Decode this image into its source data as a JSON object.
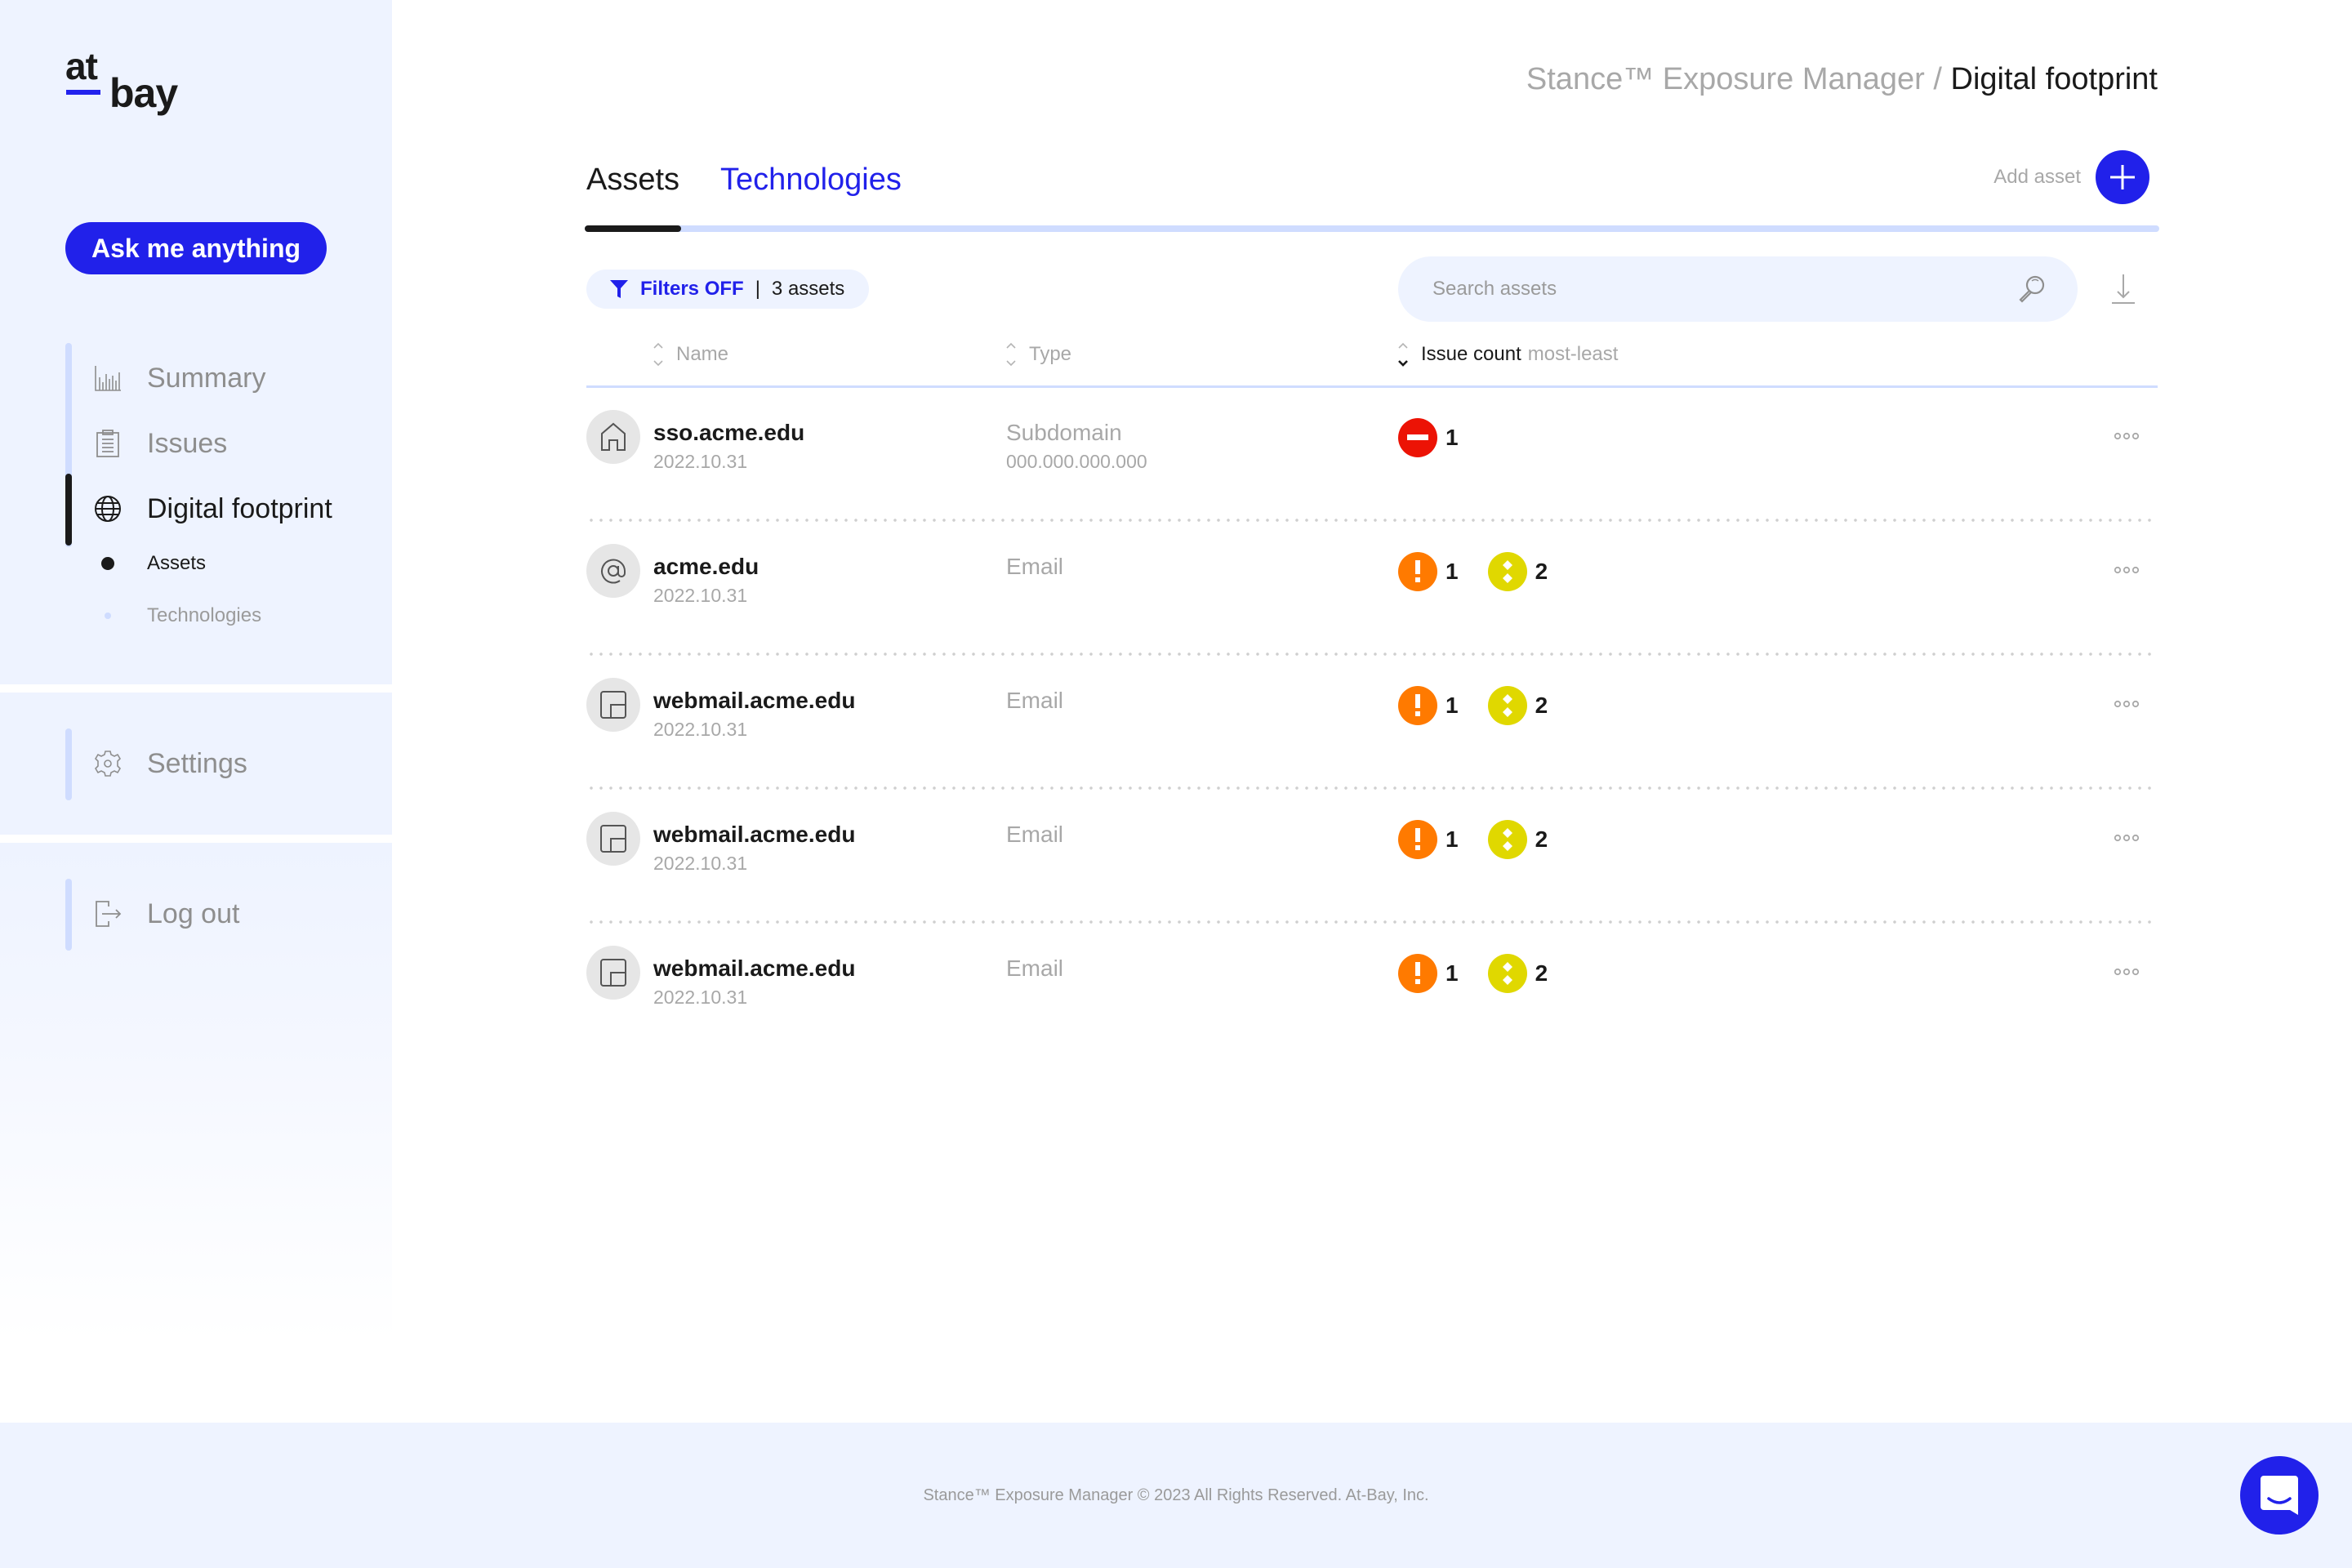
{
  "brand": {
    "logo_top": "at",
    "logo_bottom": "bay",
    "accent": "#2121ea"
  },
  "sidebar": {
    "ask_button": "Ask me anything",
    "nav": [
      {
        "label": "Summary",
        "icon": "bar-chart-icon",
        "active": false
      },
      {
        "label": "Issues",
        "icon": "clipboard-icon",
        "active": false
      },
      {
        "label": "Digital footprint",
        "icon": "globe-icon",
        "active": true
      }
    ],
    "subnav": [
      {
        "label": "Assets",
        "active": true
      },
      {
        "label": "Technologies",
        "active": false
      }
    ],
    "settings": {
      "label": "Settings",
      "icon": "gear-icon"
    },
    "logout": {
      "label": "Log out",
      "icon": "logout-icon"
    }
  },
  "header": {
    "breadcrumb_root": "Stance™ Exposure Manager",
    "breadcrumb_sep": " / ",
    "breadcrumb_current": "Digital footprint"
  },
  "tabs": [
    {
      "label": "Assets",
      "active": true
    },
    {
      "label": "Technologies",
      "active": false
    }
  ],
  "add_asset": {
    "label": "Add asset",
    "icon": "plus-icon"
  },
  "filters": {
    "label": "Filters OFF",
    "separator": "|",
    "count": "3 assets"
  },
  "search": {
    "placeholder": "Search assets",
    "value": ""
  },
  "table": {
    "columns": [
      {
        "label": "Name",
        "suffix": ""
      },
      {
        "label": "Type",
        "suffix": ""
      },
      {
        "label": "Issue count",
        "suffix": "most-least"
      }
    ],
    "rows": [
      {
        "icon": "home-icon",
        "name": "sso.acme.edu",
        "date": "2022.10.31",
        "type": "Subdomain",
        "ip": "000.000.000.000",
        "issues": [
          {
            "severity": "critical",
            "count": "1"
          }
        ]
      },
      {
        "icon": "at-sign-icon",
        "name": "acme.edu",
        "date": "2022.10.31",
        "type": "Email",
        "ip": "",
        "issues": [
          {
            "severity": "high",
            "count": "1"
          },
          {
            "severity": "medium",
            "count": "2"
          }
        ]
      },
      {
        "icon": "window-icon",
        "name": "webmail.acme.edu",
        "date": "2022.10.31",
        "type": "Email",
        "ip": "",
        "issues": [
          {
            "severity": "high",
            "count": "1"
          },
          {
            "severity": "medium",
            "count": "2"
          }
        ]
      },
      {
        "icon": "window-icon",
        "name": "webmail.acme.edu",
        "date": "2022.10.31",
        "type": "Email",
        "ip": "",
        "issues": [
          {
            "severity": "high",
            "count": "1"
          },
          {
            "severity": "medium",
            "count": "2"
          }
        ]
      },
      {
        "icon": "window-icon",
        "name": "webmail.acme.edu",
        "date": "2022.10.31",
        "type": "Email",
        "ip": "",
        "issues": [
          {
            "severity": "high",
            "count": "1"
          },
          {
            "severity": "medium",
            "count": "2"
          }
        ]
      }
    ]
  },
  "severity_colors": {
    "critical": "#ec1305",
    "high": "#ff7a00",
    "medium": "#e0d800"
  },
  "footer": {
    "copyright": "Stance™ Exposure Manager © 2023 All Rights Reserved. At-Bay, Inc."
  },
  "chat": {
    "icon": "chat-icon"
  }
}
